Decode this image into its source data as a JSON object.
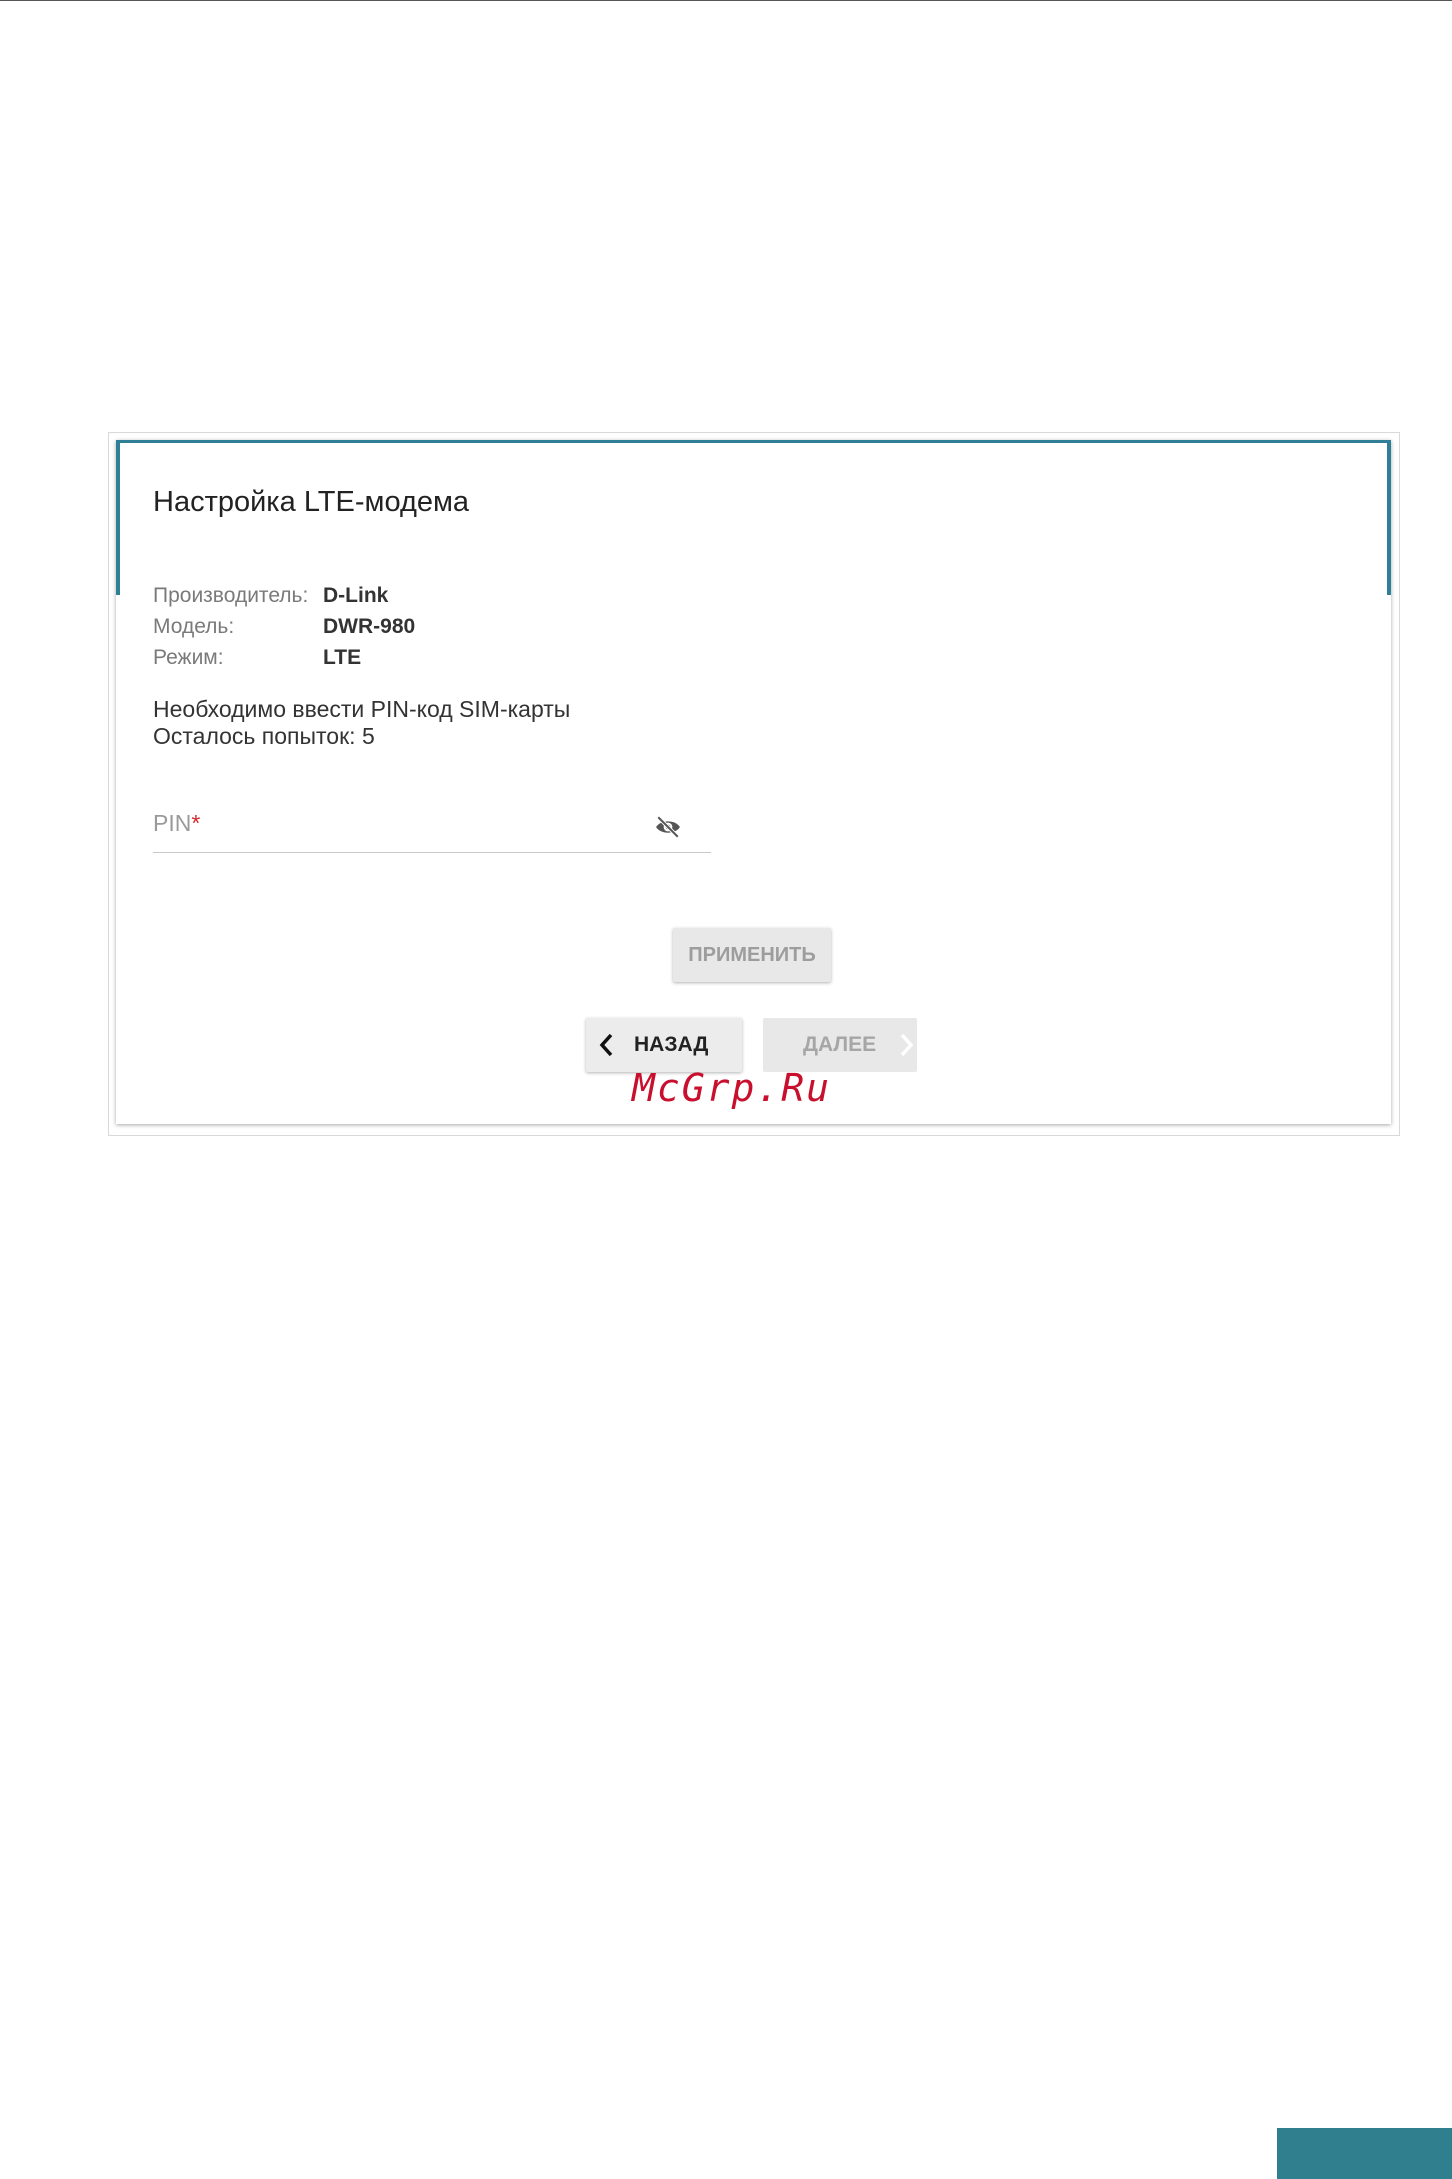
{
  "dialog": {
    "title": "Настройка LTE-модема",
    "info": [
      {
        "label": "Производитель:",
        "value": "D-Link"
      },
      {
        "label": "Модель:",
        "value": "DWR-980"
      },
      {
        "label": "Режим:",
        "value": "LTE"
      }
    ],
    "message_line1": "Необходимо ввести PIN-код SIM-карты",
    "message_line2": "Осталось попыток: 5",
    "pin": {
      "label": "PIN",
      "required_mark": "*",
      "value": ""
    },
    "apply_label": "ПРИМЕНИТЬ",
    "back_label": "НАЗАД",
    "next_label": "ДАЛЕЕ"
  },
  "watermark": "McGrp.Ru",
  "colors": {
    "accent": "#2f7f96",
    "required": "#d9262c",
    "watermark": "#c8102e"
  }
}
